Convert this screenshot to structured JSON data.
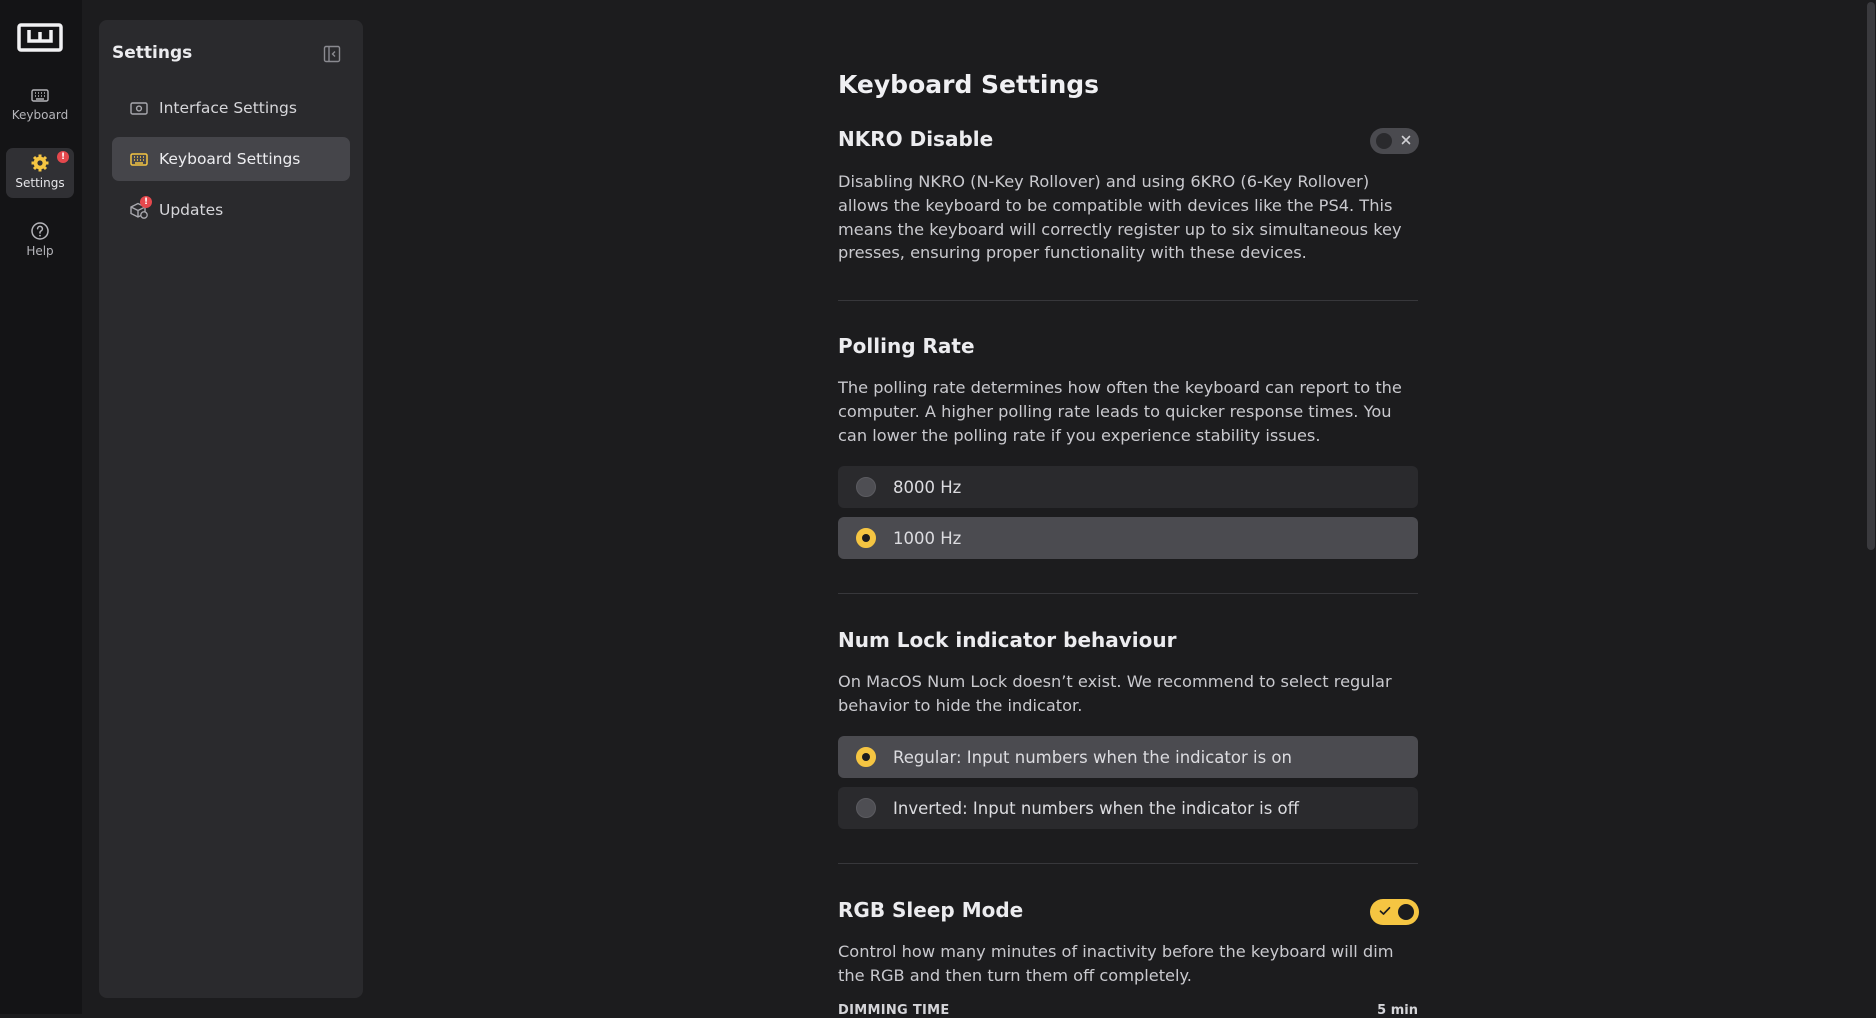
{
  "rail": {
    "items": [
      {
        "label": "Keyboard",
        "icon": "keyboard-icon"
      },
      {
        "label": "Settings",
        "icon": "gear-icon",
        "badge": "!"
      },
      {
        "label": "Help",
        "icon": "help-icon"
      }
    ]
  },
  "panel": {
    "title": "Settings",
    "items": [
      {
        "label": "Interface Settings",
        "icon": "interface-icon"
      },
      {
        "label": "Keyboard Settings",
        "icon": "keyboard-icon"
      },
      {
        "label": "Updates",
        "icon": "updates-icon",
        "badge": "!"
      }
    ]
  },
  "main": {
    "title": "Keyboard Settings",
    "nkro": {
      "title": "NKRO Disable",
      "enabled": false,
      "description": "Disabling NKRO (N-Key Rollover) and using 6KRO (6-Key Rollover) allows the keyboard to be compatible with devices like the PS4. This means the keyboard will correctly register up to six simultaneous key presses, ensuring proper functionality with these devices."
    },
    "polling": {
      "title": "Polling Rate",
      "description": "The polling rate determines how often the keyboard can report to the computer. A higher polling rate leads to quicker response times. You can lower the polling rate if you experience stability issues.",
      "options": [
        {
          "label": "8000 Hz",
          "selected": false
        },
        {
          "label": "1000 Hz",
          "selected": true
        }
      ]
    },
    "numlock": {
      "title": "Num Lock indicator behaviour",
      "description": "On MacOS Num Lock doesn’t exist. We recommend to select regular behavior to hide the indicator.",
      "options": [
        {
          "label": "Regular: Input numbers when the indicator is on",
          "selected": true
        },
        {
          "label": "Inverted: Input numbers when the indicator is off",
          "selected": false
        }
      ]
    },
    "rgb_sleep": {
      "title": "RGB Sleep Mode",
      "enabled": true,
      "description": "Control how many minutes of inactivity before the keyboard will dim the RGB and then turn them off completely.",
      "dimming_label": "DIMMING TIME",
      "dimming_value": "5 min"
    }
  },
  "colors": {
    "accent": "#f5c542",
    "badge": "#e5484d",
    "background": "#1c1c1e",
    "panel": "#2a2a2d"
  }
}
